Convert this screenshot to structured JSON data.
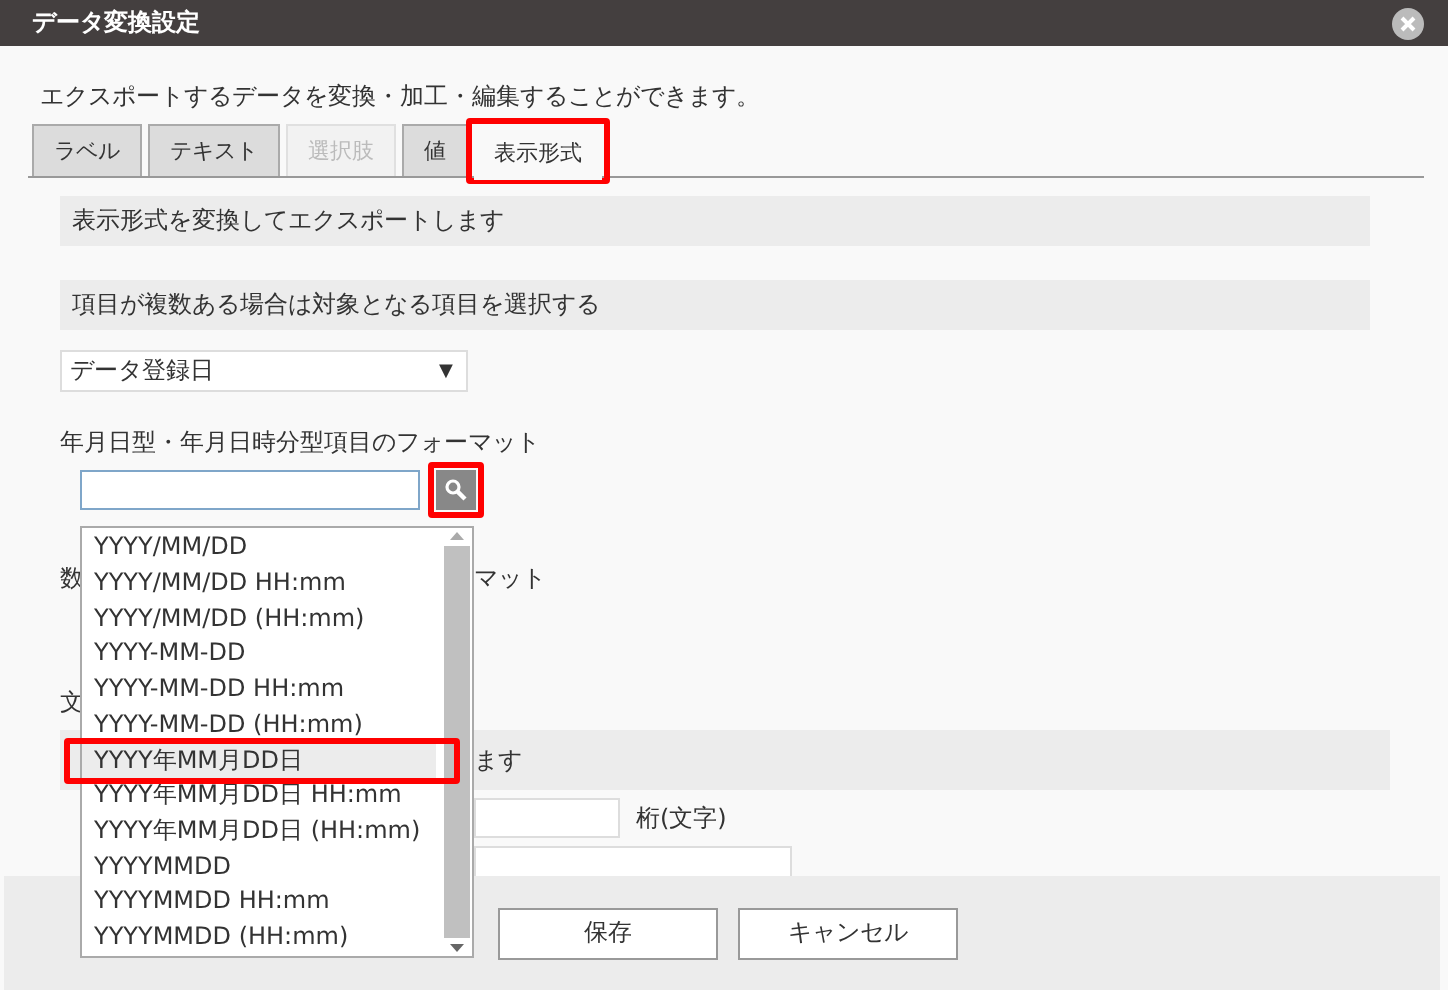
{
  "window": {
    "title": "データ変換設定"
  },
  "description": "エクスポートするデータを変換・加工・編集することができます。",
  "tabs": [
    {
      "label": "ラベル",
      "selected": false,
      "disabled": false,
      "highlighted": false
    },
    {
      "label": "テキスト",
      "selected": false,
      "disabled": false,
      "highlighted": false
    },
    {
      "label": "選択肢",
      "selected": false,
      "disabled": true,
      "highlighted": false
    },
    {
      "label": "値",
      "selected": false,
      "disabled": false,
      "highlighted": false
    },
    {
      "label": "表示形式",
      "selected": true,
      "disabled": false,
      "highlighted": true
    }
  ],
  "info_bar": "表示形式を変換してエクスポートします",
  "target_bar": "項目が複数ある場合は対象となる項目を選択する",
  "target_select": {
    "value": "データ登録日",
    "arrow": "▼"
  },
  "date_format": {
    "label": "年月日型・年月日時分型項目のフォーマット",
    "search_highlighted": true
  },
  "format_list": {
    "items": [
      {
        "label": "YYYY/MM/DD",
        "selected": false,
        "highlighted": false
      },
      {
        "label": "YYYY/MM/DD HH:mm",
        "selected": false,
        "highlighted": false
      },
      {
        "label": "YYYY/MM/DD (HH:mm)",
        "selected": false,
        "highlighted": false
      },
      {
        "label": "YYYY-MM-DD",
        "selected": false,
        "highlighted": false
      },
      {
        "label": "YYYY-MM-DD HH:mm",
        "selected": false,
        "highlighted": false
      },
      {
        "label": "YYYY-MM-DD (HH:mm)",
        "selected": false,
        "highlighted": false
      },
      {
        "label": "YYYY年MM月DD日",
        "selected": true,
        "highlighted": true
      },
      {
        "label": "YYYY年MM月DD日 HH:mm",
        "selected": false,
        "highlighted": false
      },
      {
        "label": "YYYY年MM月DD日 (HH:mm)",
        "selected": false,
        "highlighted": false
      },
      {
        "label": "YYYYMMDD",
        "selected": false,
        "highlighted": false
      },
      {
        "label": "YYYYMMDD HH:mm",
        "selected": false,
        "highlighted": false
      },
      {
        "label": "YYYYMMDD (HH:mm)",
        "selected": false,
        "highlighted": false
      }
    ]
  },
  "behind_list": [
    {
      "kind": "label",
      "left": "数",
      "right": "マット"
    },
    {
      "kind": "label",
      "left": "文"
    },
    {
      "kind": "band",
      "right": "ます"
    },
    {
      "kind": "field",
      "right": "桁(文字)"
    },
    {
      "kind": "wide_field"
    }
  ],
  "buttons": [
    "保存",
    "キャンセル"
  ]
}
